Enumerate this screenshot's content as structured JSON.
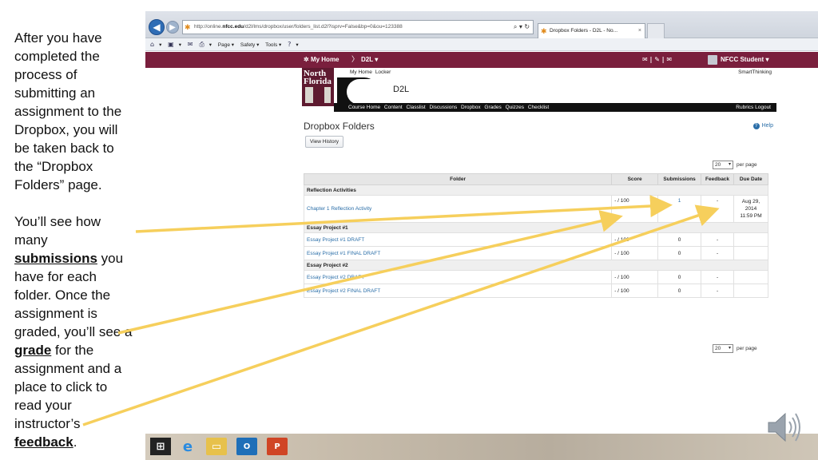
{
  "slide": {
    "para1": "After you have completed the process of submitting an assignment to the Dropbox, you will be taken back to the “Dropbox Folders” page.",
    "para2_a": "You’ll see how many ",
    "para2_b1": "submissions",
    "para2_c": " you have for each folder.  Once the assignment is graded, you’ll see a ",
    "para2_b2": "grade",
    "para2_d": " for the assignment and a place to click to read your instructor’s ",
    "para2_b3": "feedback",
    "para2_e": "."
  },
  "browser": {
    "url_pre": "http://online.",
    "url_bold": "nfcc.edu",
    "url_post": "/d2l/lms/dropbox/user/folders_list.d2l?isprv=False&bp=0&ou=123388",
    "addr_controls": "⌕ ▾ ↻",
    "tab_title": "Dropbox Folders - D2L - No...",
    "tab_close": "×",
    "cmd_items": [
      "▾",
      "▾",
      "▾",
      "Page ▾",
      "Safety ▾",
      "Tools ▾",
      "▾"
    ]
  },
  "d2l": {
    "nav": {
      "home": "My Home",
      "sep": "〉",
      "course": "D2L ▾",
      "icons": "✉ | ✎ | ✉",
      "user": "NFCC Student ▾"
    },
    "logo": {
      "line1": "North",
      "line2": "Florida"
    },
    "header_links": [
      "My Home",
      "Locker"
    ],
    "smart": "SmartThinking",
    "header_title": "D2L",
    "tabs": [
      "Course Home",
      "Content",
      "Classlist",
      "Discussions",
      "Dropbox",
      "Grades",
      "Quizzes",
      "Checklist"
    ],
    "tabs_right": "Rubrics  Logout",
    "page_title": "Dropbox Folders",
    "help": "Help",
    "view_history": "View History",
    "per_page_value": "20",
    "per_page_label": "per page",
    "columns": [
      "Folder",
      "Score",
      "Submissions",
      "Feedback",
      "Due Date"
    ],
    "categories": [
      "Reflection Activities",
      "Essay Project #1",
      "Essay Project #2"
    ],
    "rows": [
      {
        "folder": "Chapter 1 Reflection Activity",
        "score": "- / 100",
        "submissions": "1",
        "feedback": "-",
        "due_l1": "Aug 29,",
        "due_l2": "2014",
        "due_l3": "11:59 PM"
      },
      {
        "folder": "Essay Project #1 DRAFT",
        "score": "- / 100",
        "submissions": "0",
        "feedback": "-"
      },
      {
        "folder": "Essay Project #1 FINAL DRAFT",
        "score": "- / 100",
        "submissions": "0",
        "feedback": "-"
      },
      {
        "folder": "Essay Project #2 DRAFT",
        "score": "- / 100",
        "submissions": "0",
        "feedback": "-"
      },
      {
        "folder": "Essay Project #2 FINAL DRAFT",
        "score": "- / 100",
        "submissions": "0",
        "feedback": "-"
      }
    ]
  },
  "taskbar": {
    "outlook": "O",
    "ppt": "P"
  },
  "colors": {
    "arrow": "#f6cf5c",
    "nav_maroon": "#7a1f3d",
    "link_blue": "#2a6ea8"
  },
  "icons": [
    "back-arrow-icon",
    "forward-arrow-icon",
    "refresh-icon",
    "home-icon",
    "print-icon",
    "help-icon",
    "windows-start-icon",
    "internet-explorer-icon",
    "file-explorer-icon",
    "outlook-icon",
    "powerpoint-icon",
    "speaker-icon"
  ]
}
